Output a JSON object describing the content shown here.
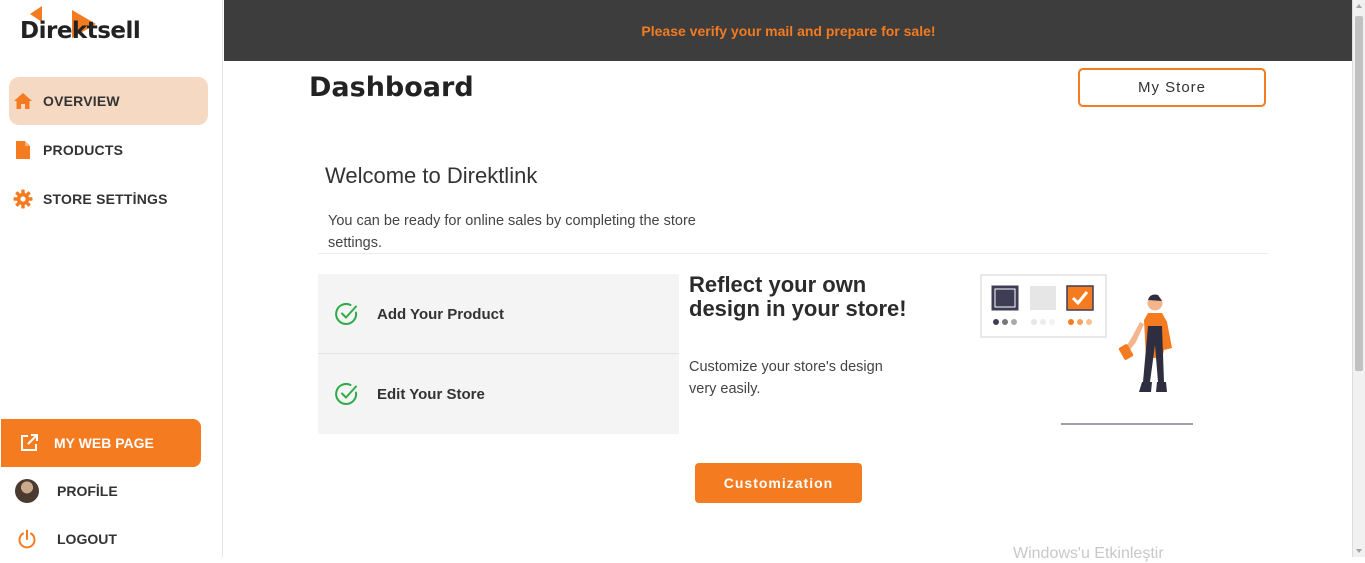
{
  "app": {
    "name": "Direktsell"
  },
  "sidebar": {
    "items": [
      {
        "label": "OVERVIEW",
        "icon": "home-icon",
        "active": true
      },
      {
        "label": "PRODUCTS",
        "icon": "document-icon",
        "active": false
      },
      {
        "label": "STORE SETTİNGS",
        "icon": "gear-icon",
        "active": false
      }
    ],
    "web_page_label": "MY WEB PAGE",
    "profile_label": "PROFİLE",
    "logout_label": "LOGOUT"
  },
  "topbar": {
    "message": "Please verify your mail and prepare for sale!"
  },
  "main": {
    "title": "Dashboard",
    "my_store_label": "My Store",
    "welcome_title": "Welcome to Direktlink",
    "welcome_desc": "You can be ready for online sales by completing the store settings.",
    "steps": [
      {
        "label": "Add Your Product",
        "done": true
      },
      {
        "label": "Edit Your Store",
        "done": true
      }
    ],
    "promo_title": "Reflect your own design in your store!",
    "promo_desc": "Customize your store's design very easily.",
    "customization_label": "Customization",
    "watermark": "Windows'u Etkinleştir"
  },
  "colors": {
    "accent": "#f47b20",
    "topbar_bg": "#3d3d3d",
    "active_bg": "#f6d9c3",
    "check": "#2eaa4a"
  }
}
